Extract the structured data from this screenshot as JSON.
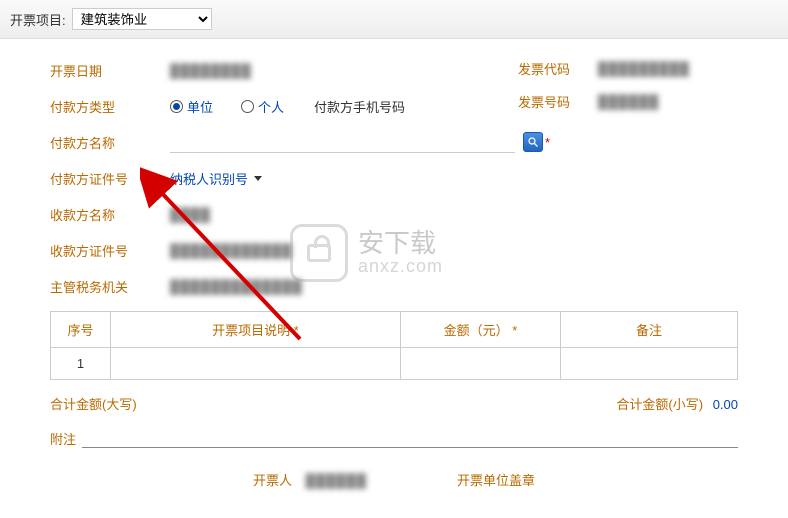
{
  "topbar": {
    "label": "开票项目:",
    "selected": "建筑装饰业"
  },
  "right": {
    "code_label": "发票代码",
    "code_value": "█████████",
    "num_label": "发票号码",
    "num_value": "██████"
  },
  "form": {
    "date_label": "开票日期",
    "date_value": "████████",
    "payer_type_label": "付款方类型",
    "radio_unit": "单位",
    "radio_person": "个人",
    "phone_label": "付款方手机号码",
    "payer_name_label": "付款方名称",
    "payer_cert_label": "付款方证件号",
    "cert_type": "纳税人识别号",
    "payee_name_label": "收款方名称",
    "payee_name_value": "████",
    "payee_cert_label": "收款方证件号",
    "payee_cert_value": "████████████",
    "tax_office_label": "主管税务机关",
    "tax_office_value": "█████████████"
  },
  "table": {
    "col_seq": "序号",
    "col_desc": "开票项目说明",
    "col_amount": "金额（元）",
    "col_note": "备注",
    "star": "*",
    "row1_seq": "1"
  },
  "totals": {
    "upper_label": "合计金额(大写)",
    "lower_label": "合计金额(小写)",
    "lower_value": "0.00"
  },
  "note": {
    "label": "附注"
  },
  "footer": {
    "issuer_label": "开票人",
    "issuer_value": "██████",
    "stamp_label": "开票单位盖章"
  },
  "watermark": {
    "cn": "安下载",
    "en": "anxz.com"
  }
}
